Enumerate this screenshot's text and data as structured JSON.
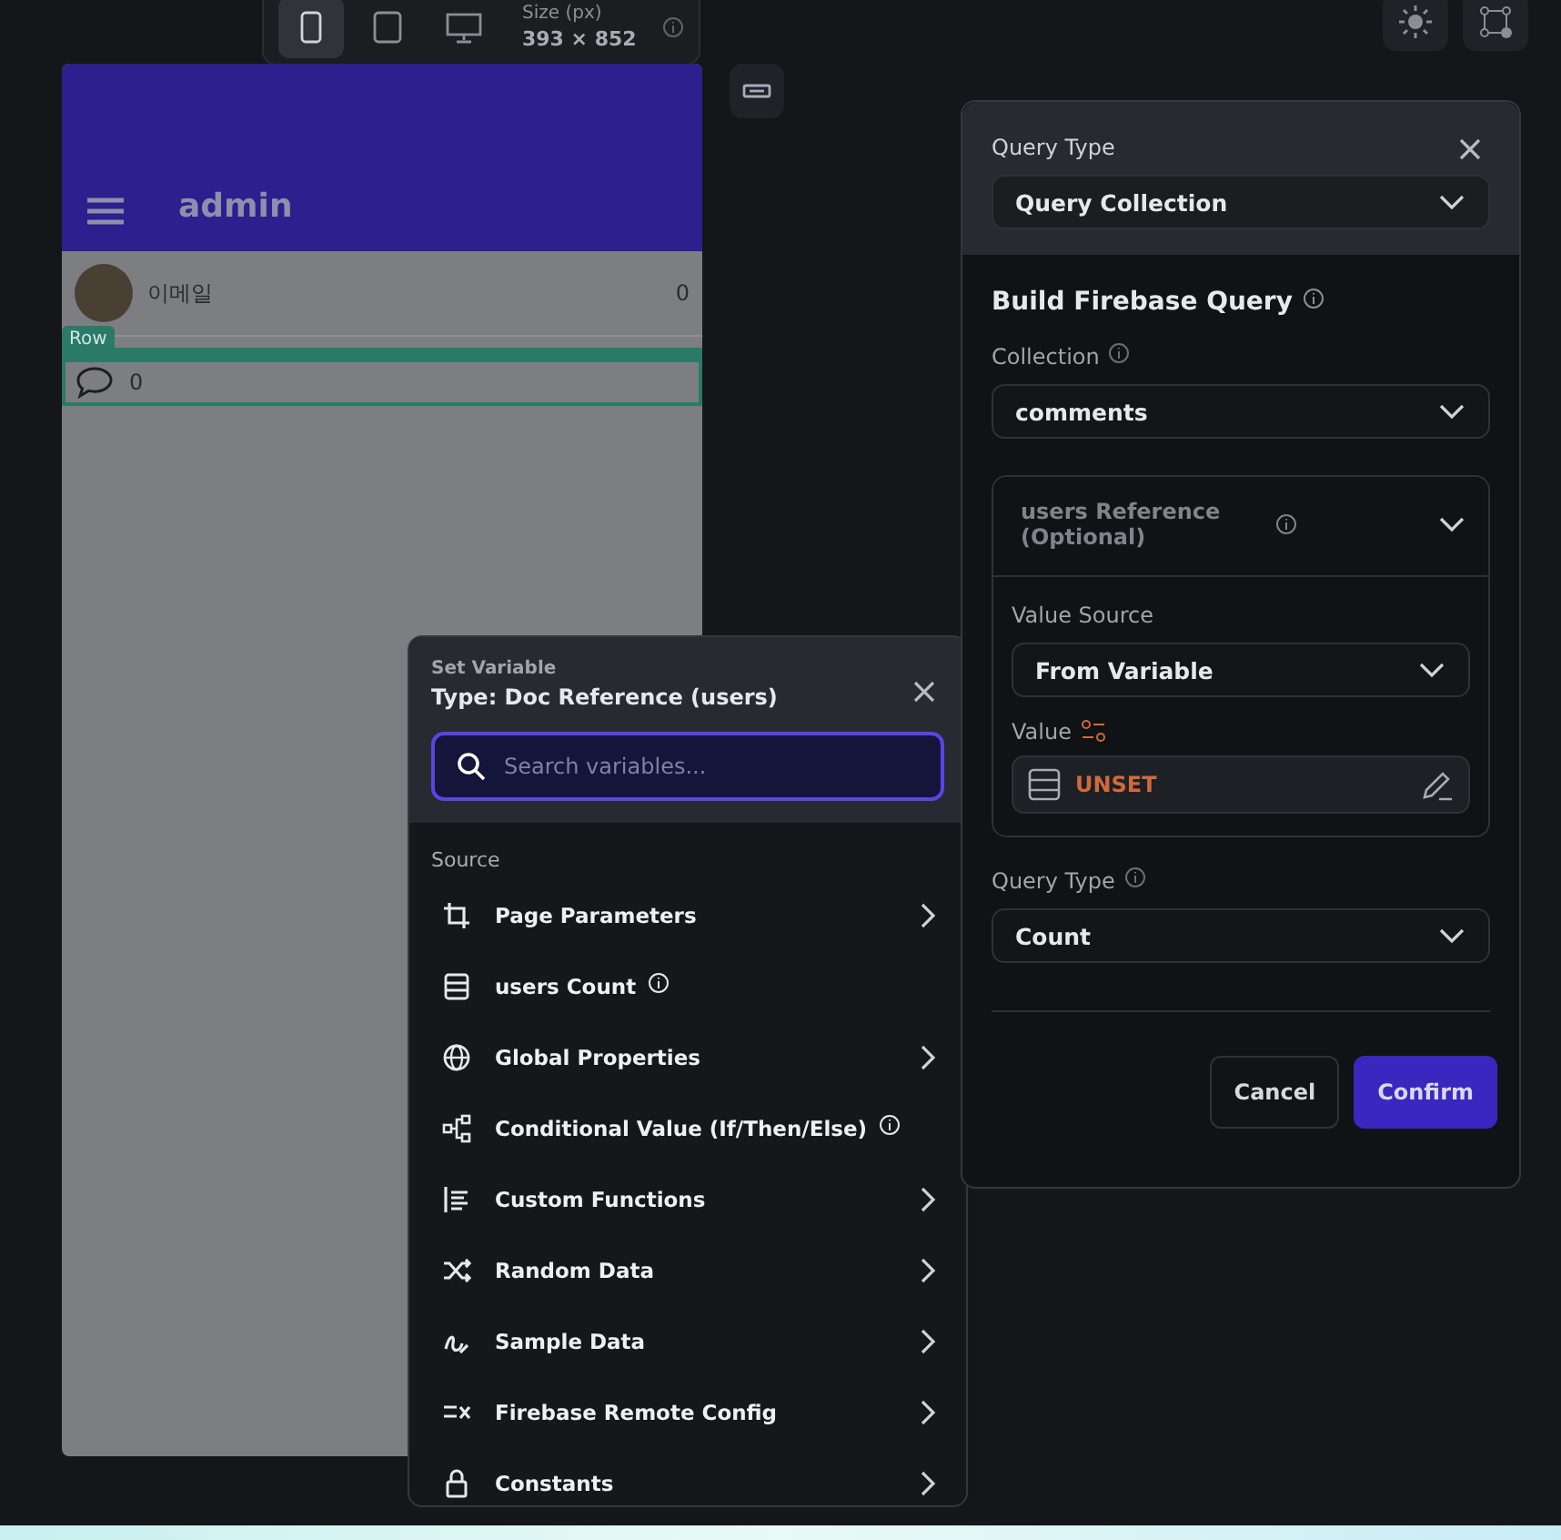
{
  "toolbar": {
    "devices": [
      {
        "selected": true
      },
      {
        "selected": false
      },
      {
        "selected": false
      }
    ],
    "size_label": "Size (px)",
    "size_value": "393 × 852"
  },
  "phone": {
    "title": "admin",
    "rows": [
      {
        "kind": "user",
        "label": "이메일",
        "count": "0"
      },
      {
        "kind": "comment",
        "count": "0",
        "selected": true,
        "badge": "Row"
      }
    ]
  },
  "set_variable": {
    "heading": "Set Variable",
    "type": "Type: Doc Reference (users)",
    "search": {
      "placeholder": "Search variables..."
    },
    "section": "Source",
    "items": [
      {
        "label": "Page Parameters",
        "kind": "submenu"
      },
      {
        "label": "users Count",
        "kind": "info"
      },
      {
        "label": "Global Properties",
        "kind": "submenu"
      },
      {
        "label": "Conditional Value (If/Then/Else)",
        "kind": "info"
      },
      {
        "label": "Custom Functions",
        "kind": "submenu"
      },
      {
        "label": "Random Data",
        "kind": "submenu"
      },
      {
        "label": "Sample Data",
        "kind": "submenu"
      },
      {
        "label": "Firebase Remote Config",
        "kind": "submenu"
      },
      {
        "label": "Constants",
        "kind": "submenu"
      }
    ]
  },
  "query_panel": {
    "query_type_label": "Query Type",
    "query_type_value": "Query Collection",
    "heading": "Build Firebase Query",
    "collection_label": "Collection",
    "collection_value": "comments",
    "reference": {
      "title": "users Reference (Optional)",
      "expanded": true,
      "value_source_label": "Value Source",
      "value_source": "From Variable",
      "value_label": "Value",
      "value": "UNSET"
    },
    "result_type_label": "Query Type",
    "result_type_value": "Count",
    "buttons": [
      "Cancel",
      "Confirm"
    ]
  }
}
